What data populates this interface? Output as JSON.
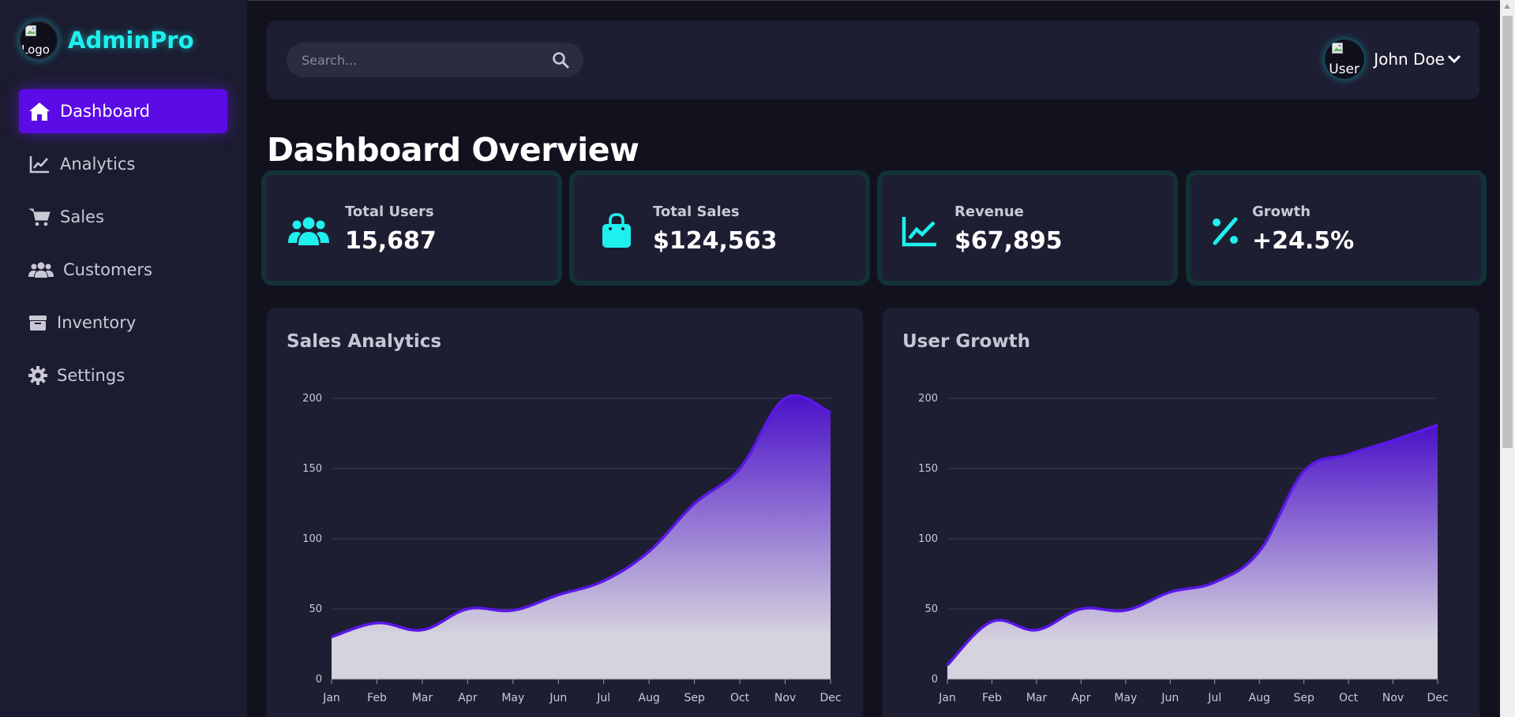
{
  "brand": {
    "logo_alt": "Logo",
    "name": "AdminPro"
  },
  "sidebar": {
    "items": [
      {
        "label": "Dashboard",
        "icon": "home-icon",
        "active": true
      },
      {
        "label": "Analytics",
        "icon": "chart-line-icon",
        "active": false
      },
      {
        "label": "Sales",
        "icon": "cart-icon",
        "active": false
      },
      {
        "label": "Customers",
        "icon": "users-icon",
        "active": false
      },
      {
        "label": "Inventory",
        "icon": "box-icon",
        "active": false
      },
      {
        "label": "Settings",
        "icon": "gear-icon",
        "active": false
      }
    ]
  },
  "header": {
    "search_placeholder": "Search...",
    "user_avatar_alt": "User",
    "user_name": "John Doe"
  },
  "page_title": "Dashboard Overview",
  "stats": [
    {
      "label": "Total Users",
      "value": "15,687",
      "icon": "users-icon"
    },
    {
      "label": "Total Sales",
      "value": "$124,563",
      "icon": "shopping-bag-icon"
    },
    {
      "label": "Revenue",
      "value": "$67,895",
      "icon": "chart-line-icon"
    },
    {
      "label": "Growth",
      "value": "+24.5%",
      "icon": "percent-icon"
    }
  ],
  "colors": {
    "accent": "#5b0be6",
    "brand": "#1ef0ee",
    "line": "#5a17e8"
  },
  "chart_data": [
    {
      "type": "area",
      "title": "Sales Analytics",
      "categories": [
        "Jan",
        "Feb",
        "Mar",
        "Apr",
        "May",
        "Jun",
        "Jul",
        "Aug",
        "Sep",
        "Oct",
        "Nov",
        "Dec"
      ],
      "values": [
        30,
        40,
        35,
        50,
        49,
        60,
        70,
        91,
        125,
        150,
        200,
        190
      ],
      "ylim": [
        0,
        200
      ],
      "yticks": [
        0,
        50,
        100,
        150,
        200
      ],
      "grid": true
    },
    {
      "type": "area",
      "title": "User Growth",
      "categories": [
        "Jan",
        "Feb",
        "Mar",
        "Apr",
        "May",
        "Jun",
        "Jul",
        "Aug",
        "Sep",
        "Oct",
        "Nov",
        "Dec"
      ],
      "values": [
        10,
        41,
        35,
        50,
        49,
        62,
        69,
        91,
        148,
        160,
        170,
        181
      ],
      "ylim": [
        0,
        200
      ],
      "yticks": [
        0,
        50,
        100,
        150,
        200
      ],
      "grid": true
    }
  ]
}
